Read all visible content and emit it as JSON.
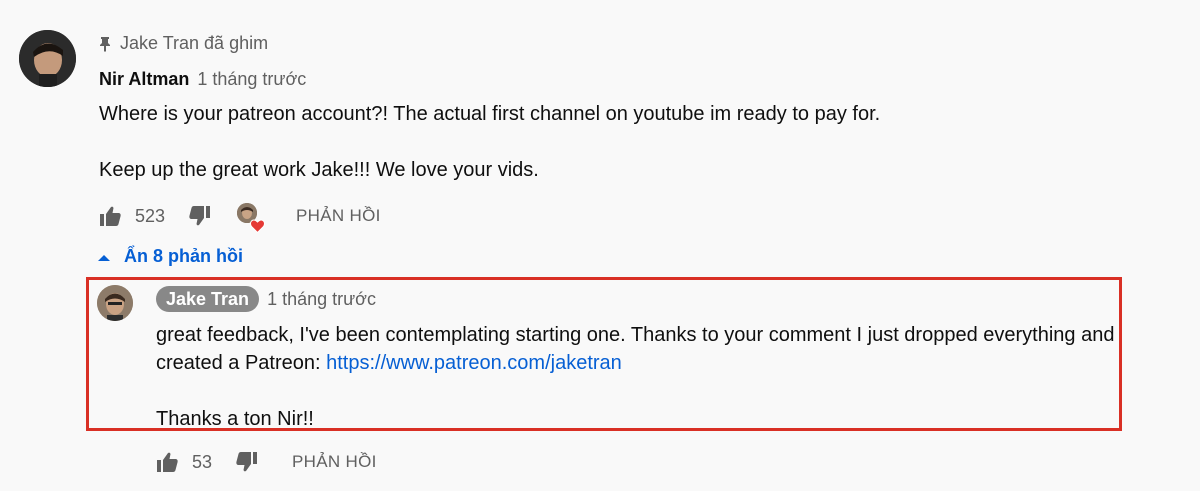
{
  "pinned": {
    "label": "Jake Tran đã ghim"
  },
  "comment": {
    "author": "Nir Altman",
    "time": "1 tháng trước",
    "lines": [
      "Where is your patreon account?! The actual first channel on youtube im ready to pay for.",
      "Keep up the great work Jake!!! We love your vids."
    ],
    "likes": "523",
    "reply_label": "PHẢN HỒI"
  },
  "replies_toggle": {
    "label": "Ẩn 8 phản hồi"
  },
  "reply": {
    "author": "Jake Tran",
    "time": "1 tháng trước",
    "line1": "great feedback, I've been contemplating starting one. Thanks to your comment I just dropped everything and",
    "line2_prefix": "created a Patreon: ",
    "link": "https://www.patreon.com/jaketran",
    "line3": "Thanks a ton Nir!!",
    "likes": "53",
    "reply_label": "PHẢN HỒI"
  },
  "colors": {
    "link": "#065fd4",
    "highlight_border": "#d93025",
    "secondary_text": "#606060",
    "owner_badge_bg": "#888888",
    "heart": "#e53935"
  },
  "icons": {
    "pin": "pin-icon",
    "like": "thumbs-up-icon",
    "dislike": "thumbs-down-icon",
    "heart": "heart-icon",
    "collapse": "caret-up-icon"
  }
}
